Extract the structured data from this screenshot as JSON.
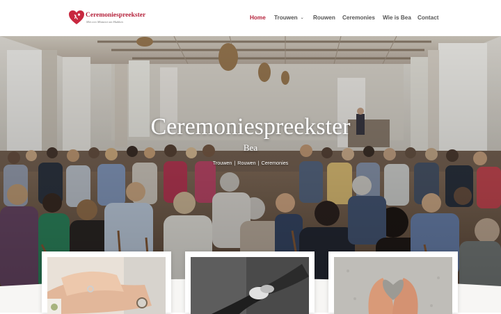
{
  "brand": {
    "name": "Ceremoniespreekster",
    "tagline": "Met  een  Moment  om  Hakken",
    "color": "#b5233c"
  },
  "nav": {
    "items": [
      {
        "label": "Home",
        "active": true
      },
      {
        "label": "Trouwen",
        "has_dropdown": true
      },
      {
        "label": "Rouwen"
      },
      {
        "label": "Ceremonies"
      },
      {
        "label": "Wie is Bea"
      },
      {
        "label": "Contact"
      }
    ]
  },
  "hero": {
    "title": "Ceremoniespreekster",
    "subtitle": "Bea",
    "links": [
      "Trouwen",
      "Rouwen",
      "Ceremonies"
    ],
    "separator": "|"
  },
  "cards": [
    {
      "image": "wedding-hands-rings"
    },
    {
      "image": "holding-hands-bw"
    },
    {
      "image": "hands-holding-stone-heart"
    }
  ]
}
